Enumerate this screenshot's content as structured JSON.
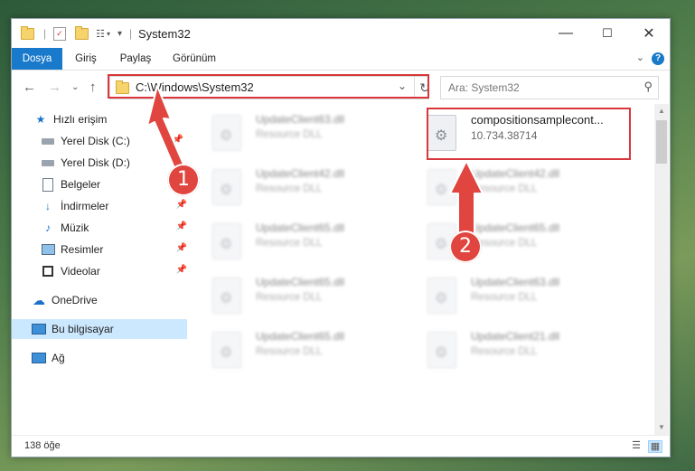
{
  "window": {
    "title": "System32",
    "controls": {
      "minimize": "—",
      "maximize": "☐",
      "close": "✕"
    }
  },
  "ribbon": {
    "tabs": [
      "Dosya",
      "Giriş",
      "Paylaş",
      "Görünüm"
    ],
    "help": "?"
  },
  "address": {
    "path": "C:\\Windows\\System32",
    "search_placeholder": "Ara: System32"
  },
  "sidebar": {
    "items": [
      {
        "label": "Hızlı erişim",
        "icon": "star-icon"
      },
      {
        "label": "Yerel Disk (C:)",
        "icon": "drive-icon"
      },
      {
        "label": "Yerel Disk (D:)",
        "icon": "drive-icon"
      },
      {
        "label": "Belgeler",
        "icon": "document-icon"
      },
      {
        "label": "İndirmeler",
        "icon": "download-icon"
      },
      {
        "label": "Müzik",
        "icon": "music-icon"
      },
      {
        "label": "Resimler",
        "icon": "pictures-icon"
      },
      {
        "label": "Videolar",
        "icon": "video-icon"
      },
      {
        "label": "OneDrive",
        "icon": "cloud-icon"
      },
      {
        "label": "Bu bilgisayar",
        "icon": "computer-icon"
      },
      {
        "label": "Ağ",
        "icon": "network-icon"
      }
    ]
  },
  "files": {
    "highlighted": {
      "name": "compositionsamplecont...",
      "detail": "10.734.38714"
    },
    "left": [
      {
        "name": "UpdateClient63.dll",
        "detail": "Resource DLL"
      },
      {
        "name": "UpdateClient42.dll",
        "detail": "Resource DLL"
      },
      {
        "name": "UpdateClient65.dll",
        "detail": "Resource DLL"
      },
      {
        "name": "UpdateClient65.dll",
        "detail": "Resource DLL"
      },
      {
        "name": "UpdateClient65.dll",
        "detail": "Resource DLL"
      }
    ],
    "right": [
      {
        "name": "UpdateClient42.dll",
        "detail": "Resource DLL"
      },
      {
        "name": "UpdateClient65.dll",
        "detail": "Resource DLL"
      },
      {
        "name": "UpdateClient63.dll",
        "detail": "Resource DLL"
      },
      {
        "name": "UpdateClient21.dll",
        "detail": "Resource DLL"
      }
    ]
  },
  "status": {
    "count": "138 öğe"
  },
  "annotations": {
    "badge1": "1",
    "badge2": "2",
    "color": "#e0453f"
  }
}
